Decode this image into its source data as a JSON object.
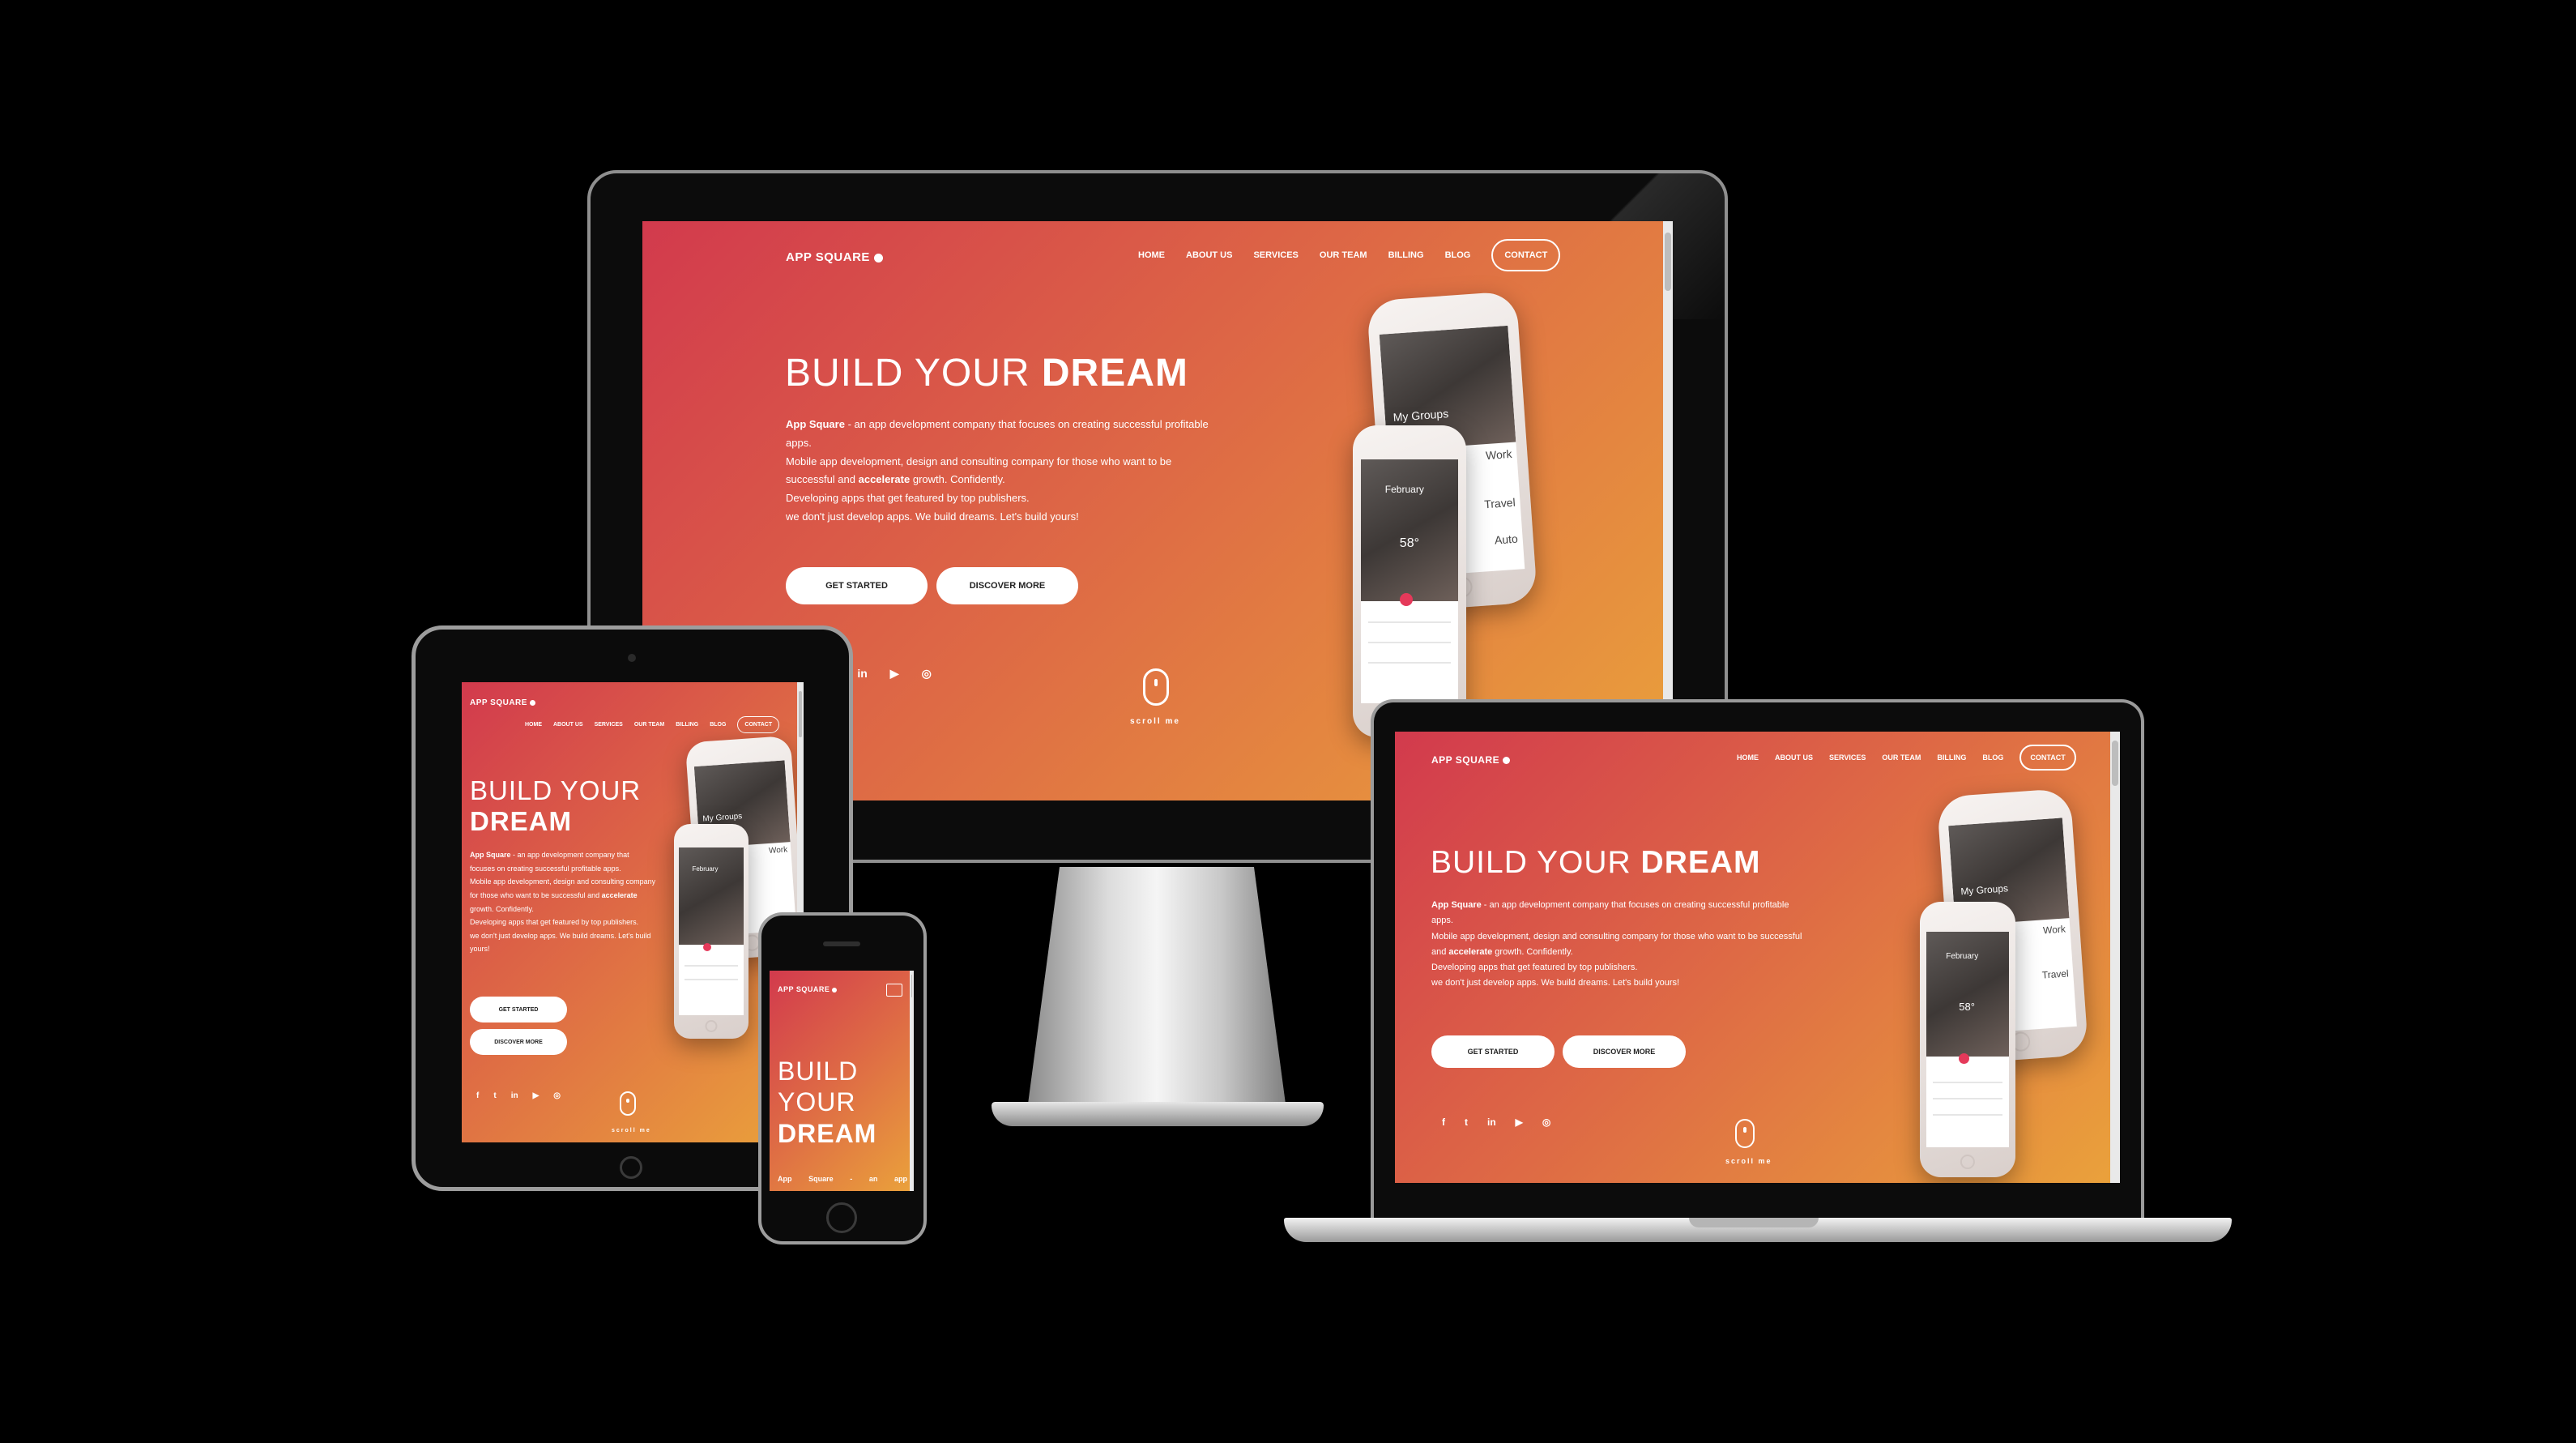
{
  "site": {
    "logo": "APP SQUARE",
    "nav": [
      "HOME",
      "ABOUT US",
      "SERVICES",
      "OUR TEAM",
      "BILLING",
      "BLOG"
    ],
    "contact": "CONTACT",
    "headline_light": "BUILD YOUR",
    "headline_bold": "DREAM",
    "brand": "App Square",
    "desc_1": " - an app development company that focuses on creating successful profitable apps.",
    "desc_2": "Mobile app development, design and consulting company for those who want to be successful and ",
    "desc_accent": "accelerate",
    "desc_3": " growth. Confidently.",
    "desc_4": "Developing apps that get featured by top publishers.",
    "desc_5": "we don't just develop apps. We build dreams. Let's build yours!",
    "get_started": "GET STARTED",
    "discover_more": "DISCOVER MORE",
    "social": [
      "f",
      "t",
      "in",
      "▶",
      "◎"
    ],
    "scroll": "scroll me",
    "phone_screen": {
      "groups": "My Groups",
      "month": "February",
      "work": "Work",
      "travel": "Travel",
      "auto": "Auto",
      "temp": "58°"
    },
    "mobile_headline": [
      "BUILD",
      "YOUR",
      "DREAM"
    ],
    "mobile_desc": [
      "App",
      "Square",
      "-",
      "an",
      "app"
    ]
  },
  "colors": {
    "gradient_start": "#d23a4d",
    "gradient_mid": "#de6a45",
    "gradient_end": "#eaa23b",
    "background": "#000000"
  }
}
